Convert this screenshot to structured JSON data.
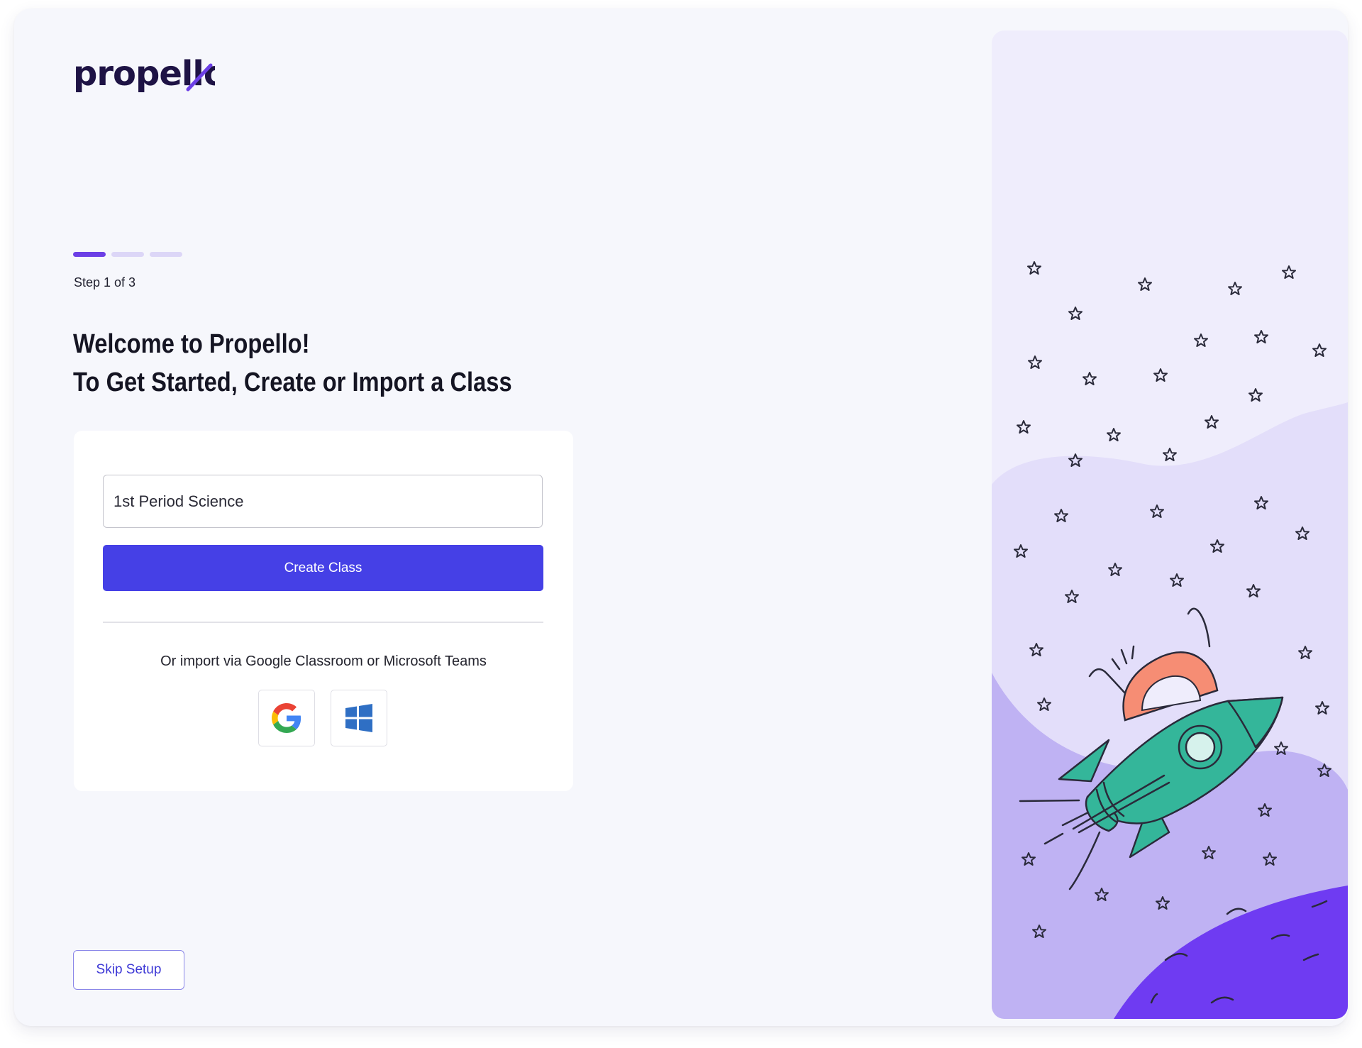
{
  "brand": {
    "logo_text": "propello"
  },
  "progress": {
    "current_step": 1,
    "total_steps": 3,
    "label": "Step 1 of 3"
  },
  "heading": {
    "line1": "Welcome to Propello!",
    "line2": "To Get Started, Create or Import a Class"
  },
  "create_class": {
    "input_value": "1st Period Science",
    "button_label": "Create Class"
  },
  "import": {
    "text": "Or import via Google Classroom or Microsoft Teams",
    "providers": [
      {
        "name": "Google Classroom",
        "icon": "google-icon"
      },
      {
        "name": "Microsoft Teams",
        "icon": "windows-icon"
      }
    ]
  },
  "footer": {
    "skip_label": "Skip Setup"
  },
  "illustration": {
    "subject": "rocket-in-space",
    "colors": {
      "sky": "#efedfc",
      "band": "#e2dcf9",
      "hill": "#bdb0f2",
      "planet": "#6f3bf2",
      "rocket": "#34b69a",
      "fin": "#f68d74"
    }
  },
  "colors": {
    "accent": "#4540e6",
    "progress_active": "#6c3fe6",
    "progress_inactive": "#dcd6f7",
    "background": "#f6f7fc"
  }
}
